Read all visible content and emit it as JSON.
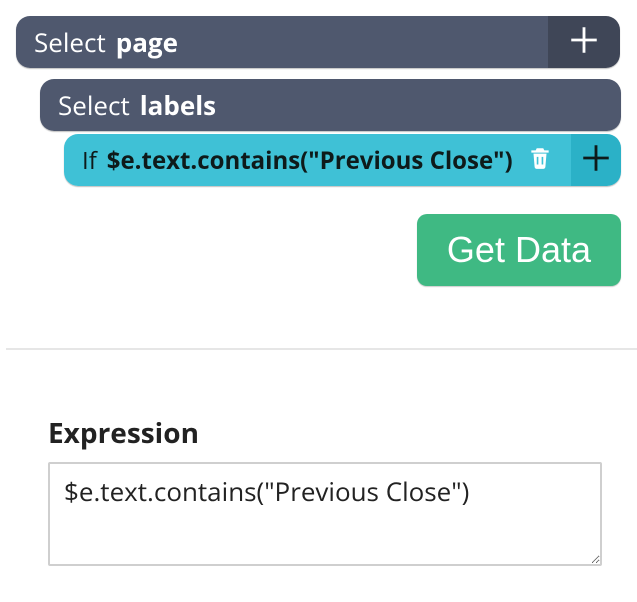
{
  "rows": {
    "page": {
      "verb": "Select",
      "noun": "page"
    },
    "labels": {
      "verb": "Select",
      "noun": "labels"
    },
    "cond": {
      "if": "If",
      "expr": "$e.text.contains(\"Previous Close\")"
    }
  },
  "buttons": {
    "get_data": "Get Data"
  },
  "expression": {
    "label": "Expression",
    "value": "$e.text.contains(\"Previous Close\")"
  }
}
